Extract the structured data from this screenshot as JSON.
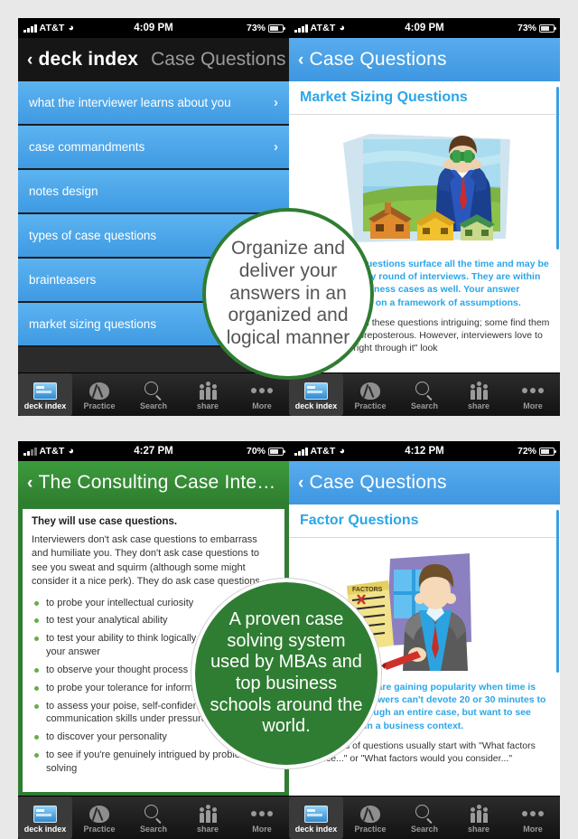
{
  "app": {
    "accent_blue": "#3f9ae2",
    "accent_green": "#2f7d32",
    "title_blue": "#2ba6e8"
  },
  "tabbar": {
    "items": [
      {
        "label": "deck index",
        "icon": "deck-index-icon",
        "active": true
      },
      {
        "label": "Practice",
        "icon": "brain-icon",
        "active": false
      },
      {
        "label": "Search",
        "icon": "search-icon",
        "active": false
      },
      {
        "label": "share",
        "icon": "people-icon",
        "active": false
      },
      {
        "label": "More",
        "icon": "ellipsis-icon",
        "active": false
      }
    ]
  },
  "panel1": {
    "status": {
      "carrier": "AT&T",
      "time": "4:09 PM",
      "battery": "73%",
      "signal_icon": "signal-bars-icon",
      "wifi_icon": "wifi-icon",
      "battery_icon": "battery-icon"
    },
    "nav": {
      "back_label": "deck index",
      "back_icon": "chevron-left-icon",
      "title": "Case Questions"
    },
    "list": [
      {
        "label": "what the interviewer learns about you",
        "arrow": "›"
      },
      {
        "label": "case commandments",
        "arrow": "›"
      },
      {
        "label": "notes design",
        "arrow": ""
      },
      {
        "label": "types of case questions",
        "arrow": ""
      },
      {
        "label": "brainteasers",
        "arrow": ""
      },
      {
        "label": "market sizing questions",
        "arrow": ""
      }
    ]
  },
  "panel2": {
    "status": {
      "carrier": "AT&T",
      "time": "4:09 PM",
      "battery": "73%"
    },
    "nav": {
      "back_label": "Case Questions",
      "back_icon": "chevron-left-icon"
    },
    "article": {
      "title": "Market Sizing Questions",
      "image_name": "man-with-binoculars-houses-illustration",
      "paragraphs": [
        "Market sizing questions surface all the time and may be asked during any round of interviews. They are within many larger business cases as well. Your answer should be based on a framework of assumptions.",
        "Interviewees find these questions intriguing; some find them boring, others preposterous. However, interviewers love to have the \"rip right through it\" look"
      ]
    }
  },
  "panel3": {
    "status": {
      "carrier": "AT&T",
      "time": "4:27 PM",
      "battery": "70%"
    },
    "nav": {
      "back_label": "The Consulting Case Inte…",
      "back_icon": "chevron-left-icon"
    },
    "article": {
      "heading": "They will use case questions.",
      "paragraph": "Interviewers don't ask case questions to embarrass and humiliate you. They don't ask case questions to see you sweat and squirm (although some might consider it a nice perk). They do ask case questions...",
      "bullets": [
        "to probe your intellectual curiosity",
        "to test your analytical ability",
        "to test your ability to think logically and organize your answer",
        "to observe your thought process",
        "to probe your tolerance for information overload",
        "to assess your poise, self-confidence and communication skills under pressure",
        "to discover your personality",
        "to see if you're genuinely intrigued by problem-solving"
      ]
    }
  },
  "panel4": {
    "status": {
      "carrier": "AT&T",
      "time": "4:12 PM",
      "battery": "72%"
    },
    "nav": {
      "back_label": "Case Questions",
      "back_icon": "chevron-left-icon"
    },
    "article": {
      "title": "Factor Questions",
      "image_name": "businessman-factors-clipboard-illustration",
      "paragraphs": [
        "Factor questions are gaining popularity when time is short and interviewers can't devote 20 or 30 minutes to walking you through an entire case, but want to see how you think in a business context.",
        "These types of questions usually start with \"What factors influence...\" or \"What factors would you consider...\""
      ]
    }
  },
  "callouts": {
    "top": "Organize and deliver your answers in an organized and logical manner",
    "bottom": "A proven case solving system used by MBAs and top business schools around the world."
  }
}
